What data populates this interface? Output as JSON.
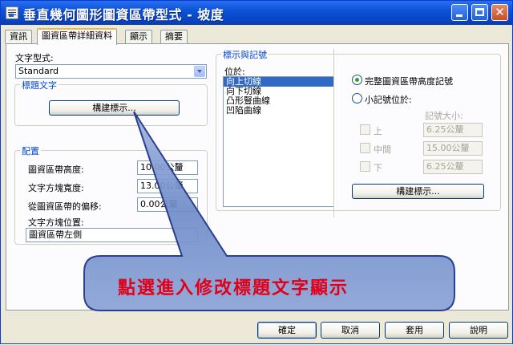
{
  "window": {
    "title": "垂直幾何圖形圖資區帶型式 - 坡度"
  },
  "tabs": [
    "資訊",
    "圖資區帶詳細資料",
    "顯示",
    "摘要"
  ],
  "text_style": {
    "label": "文字型式:",
    "value": "Standard"
  },
  "title_text_group": {
    "title": "標題文字",
    "button": "構建標示..."
  },
  "config_group": {
    "title": "配置",
    "rows": [
      {
        "label": "圖資區帶高度:",
        "value": "10.00公釐"
      },
      {
        "label": "文字方塊寬度:",
        "value": "13.00公釐"
      },
      {
        "label": "從圖資區帶的偏移:",
        "value": "0.00公釐"
      }
    ],
    "position_label": "文字方塊位置:",
    "position_value": "圖資區帶左側"
  },
  "markers_group": {
    "title": "標示與記號",
    "position_label": "位於:",
    "list": [
      "向上切線",
      "向下切線",
      "凸形豎曲線",
      "凹陷曲線"
    ],
    "selected_index": 0
  },
  "right_options": {
    "radio_full": "完整圖資區帶高度記號",
    "radio_small": "小記號位於:",
    "marker_size_label": "記號大小:",
    "checks": [
      {
        "label": "上",
        "value": "6.25公釐"
      },
      {
        "label": "中間",
        "value": "15.00公釐"
      },
      {
        "label": "下",
        "value": "6.25公釐"
      }
    ],
    "button": "構建標示..."
  },
  "callout": {
    "text": "點選進入修改標題文字顯示"
  },
  "footer": {
    "ok": "確定",
    "cancel": "取消",
    "apply": "套用",
    "help": "說明"
  },
  "colors": {
    "titlebar": "#0b53d6",
    "accent": "#0046d5",
    "callout_fill": "#6f8cc8",
    "callout_text": "#e0001a"
  }
}
